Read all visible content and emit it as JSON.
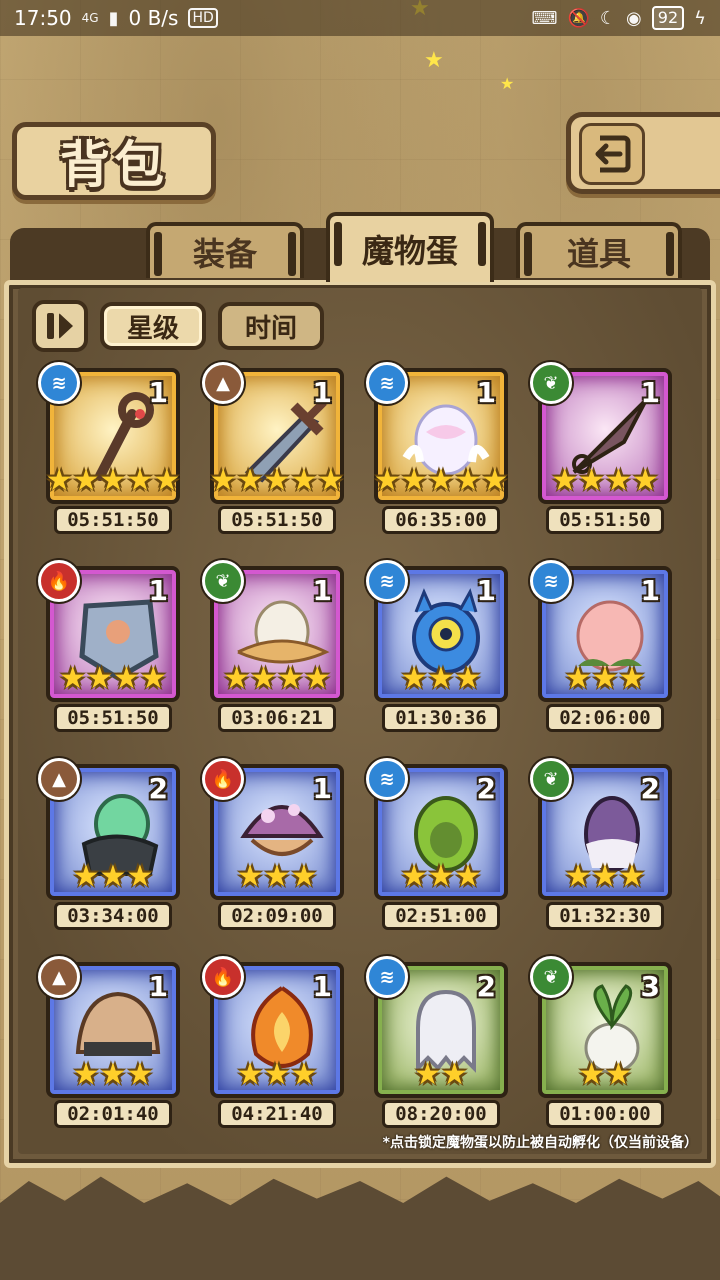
{
  "status_bar": {
    "time": "17:50",
    "network": "4G",
    "speed": "0 B/s",
    "hd": "HD",
    "battery": "92"
  },
  "header": {
    "title": "背包",
    "back_icon": "return-arrow-icon"
  },
  "tabs": [
    {
      "label": "装备",
      "active": false
    },
    {
      "label": "魔物蛋",
      "active": true
    },
    {
      "label": "道具",
      "active": false
    }
  ],
  "sort": {
    "toggle_icon": "play-pause-icon",
    "options": [
      {
        "label": "星级",
        "active": true
      },
      {
        "label": "时间",
        "active": false
      }
    ]
  },
  "eggs": [
    {
      "element": "water",
      "qty": "1",
      "stars": 5,
      "rarity": "gold",
      "timer": "05:51:50",
      "art": "staff"
    },
    {
      "element": "earth",
      "qty": "1",
      "stars": 5,
      "rarity": "gold",
      "timer": "05:51:50",
      "art": "sword"
    },
    {
      "element": "water",
      "qty": "1",
      "stars": 5,
      "rarity": "gold",
      "timer": "06:35:00",
      "art": "winged-egg"
    },
    {
      "element": "grass",
      "qty": "1",
      "stars": 4,
      "rarity": "purple",
      "timer": "05:51:50",
      "art": "kunai"
    },
    {
      "element": "fire",
      "qty": "1",
      "stars": 4,
      "rarity": "purple",
      "timer": "05:51:50",
      "art": "shield"
    },
    {
      "element": "grass",
      "qty": "1",
      "stars": 4,
      "rarity": "purple",
      "timer": "03:06:21",
      "art": "feather-egg"
    },
    {
      "element": "water",
      "qty": "1",
      "stars": 3,
      "rarity": "blue",
      "timer": "01:30:36",
      "art": "eye-egg"
    },
    {
      "element": "water",
      "qty": "1",
      "stars": 3,
      "rarity": "blue",
      "timer": "02:06:00",
      "art": "peach"
    },
    {
      "element": "earth",
      "qty": "2",
      "stars": 3,
      "rarity": "blue",
      "timer": "03:34:00",
      "art": "slime-armor"
    },
    {
      "element": "fire",
      "qty": "1",
      "stars": 3,
      "rarity": "blue",
      "timer": "02:09:00",
      "art": "mushroom"
    },
    {
      "element": "water",
      "qty": "2",
      "stars": 3,
      "rarity": "blue",
      "timer": "02:51:00",
      "art": "green-egg"
    },
    {
      "element": "grass",
      "qty": "2",
      "stars": 3,
      "rarity": "blue",
      "timer": "01:32:30",
      "art": "purple-egg"
    },
    {
      "element": "earth",
      "qty": "1",
      "stars": 3,
      "rarity": "blue",
      "timer": "02:01:40",
      "art": "hairy-egg"
    },
    {
      "element": "fire",
      "qty": "1",
      "stars": 3,
      "rarity": "blue",
      "timer": "04:21:40",
      "art": "fire-egg"
    },
    {
      "element": "water",
      "qty": "2",
      "stars": 2,
      "rarity": "green",
      "timer": "08:20:00",
      "art": "ghost-egg"
    },
    {
      "element": "grass",
      "qty": "3",
      "stars": 2,
      "rarity": "green",
      "timer": "01:00:00",
      "art": "turnip"
    }
  ],
  "footer_note": "*点击锁定魔物蛋以防止被自动孵化（仅当前设备）"
}
